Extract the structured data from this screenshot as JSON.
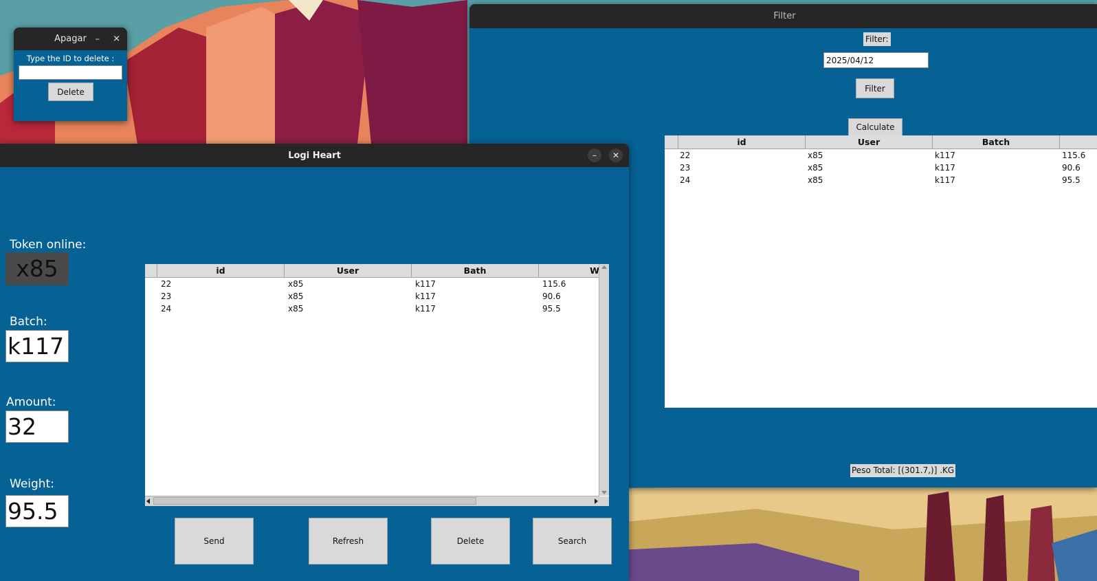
{
  "desktop": {},
  "delete_window": {
    "title": "Apagar",
    "minimize": "–",
    "close": "✕",
    "prompt": "Type the ID to delete :",
    "input_value": "",
    "delete_button": "Delete"
  },
  "filter_window": {
    "title": "Filter",
    "filter_label": "Filter:",
    "filter_input_value": "2025/04/12",
    "filter_button": "Filter",
    "calculate_button": "Calculate",
    "table": {
      "columns": [
        "id",
        "User",
        "Batch"
      ],
      "rows": [
        {
          "id": "22",
          "user": "x85",
          "batch": "k117",
          "weight": "115.6"
        },
        {
          "id": "23",
          "user": "x85",
          "batch": "k117",
          "weight": "90.6"
        },
        {
          "id": "24",
          "user": "x85",
          "batch": "k117",
          "weight": "95.5"
        }
      ]
    },
    "total_label": "Peso Total: [(301.7,)] .KG"
  },
  "main_window": {
    "title": "Logi Heart",
    "minimize": "–",
    "close": "✕",
    "token_label": "Token online:",
    "token_value": "x85",
    "batch_label": "Batch:",
    "batch_value": "k117",
    "amount_label": "Amount:",
    "amount_value": "32",
    "weight_label": "Weight:",
    "weight_value": "95.5",
    "table": {
      "columns": [
        "id",
        "User",
        "Bath",
        "We"
      ],
      "rows": [
        {
          "id": "22",
          "user": "x85",
          "bath": "k117",
          "weight": "115.6"
        },
        {
          "id": "23",
          "user": "x85",
          "bath": "k117",
          "weight": "90.6"
        },
        {
          "id": "24",
          "user": "x85",
          "bath": "k117",
          "weight": "95.5"
        }
      ]
    },
    "buttons": {
      "send": "Send",
      "refresh": "Refresh",
      "delete": "Delete",
      "search": "Search"
    }
  }
}
